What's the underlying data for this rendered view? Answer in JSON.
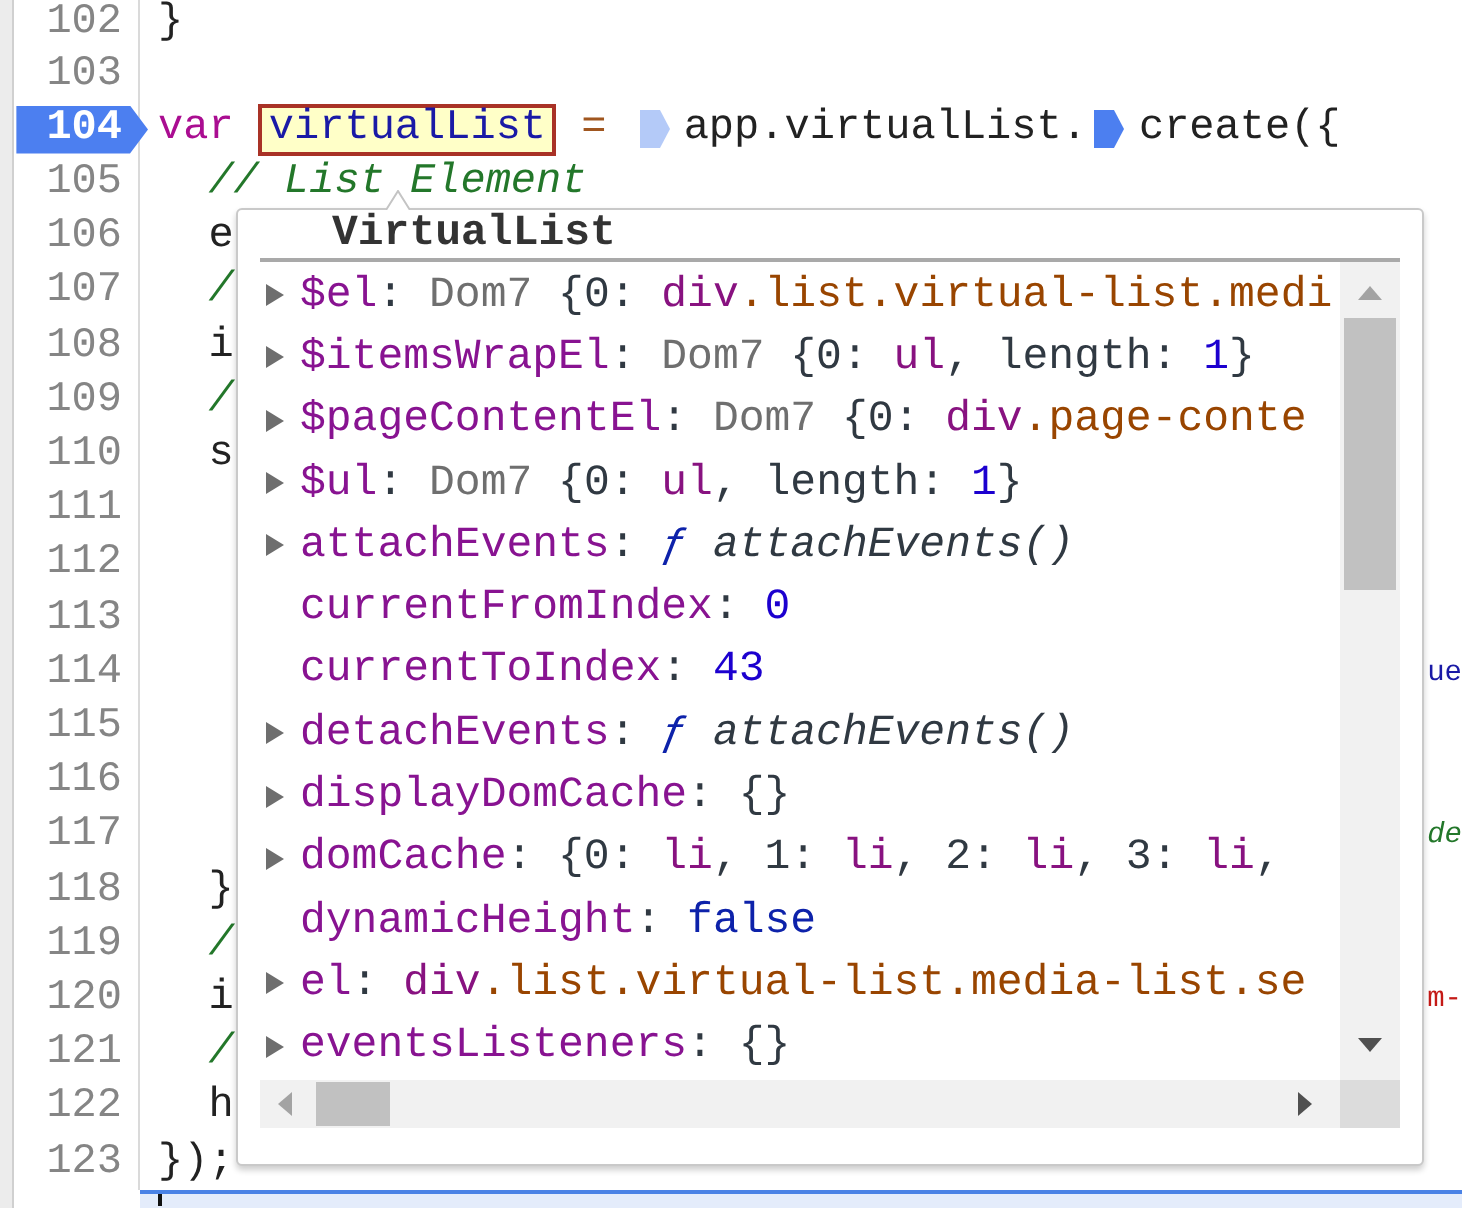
{
  "editor": {
    "lines": [
      {
        "number": "102",
        "breakpoint": false,
        "code": [
          {
            "kind": "plain",
            "text": "}"
          }
        ]
      },
      {
        "number": "103",
        "breakpoint": false
      },
      {
        "number": "104",
        "breakpoint": true,
        "code": [
          {
            "kind": "keyword",
            "text": "var"
          },
          {
            "kind": "hovered_name",
            "text": "virtualList"
          },
          {
            "kind": "operator",
            "text": "="
          },
          {
            "kind": "inline_breakpoint",
            "set": false
          },
          {
            "kind": "plain",
            "text": "app.virtualList."
          },
          {
            "kind": "inline_breakpoint",
            "set": true
          },
          {
            "kind": "plain",
            "text": "create({"
          }
        ],
        "children": [
          {
            "number": "105",
            "breakpoint": false,
            "code": [
              {
                "kind": "comment",
                "text": "// List"
              },
              {
                "kind": "comment",
                "text": "Element"
              }
            ]
          },
          {
            "number": "106",
            "breakpoint": false,
            "code": [
              {
                "kind": "plain",
                "text": "e"
              }
            ]
          },
          {
            "number": "107",
            "breakpoint": false,
            "code": [
              {
                "kind": "comment",
                "text": "/"
              }
            ]
          },
          {
            "number": "108",
            "breakpoint": false,
            "code": [
              {
                "kind": "plain",
                "text": "i"
              }
            ]
          },
          {
            "number": "109",
            "breakpoint": false,
            "code": [
              {
                "kind": "comment",
                "text": "/"
              }
            ]
          },
          {
            "number": "110",
            "breakpoint": false,
            "code": [
              {
                "kind": "plain",
                "text": "s"
              }
            ]
          },
          {
            "number": "111",
            "breakpoint": false
          },
          {
            "number": "112",
            "breakpoint": false
          },
          {
            "number": "113",
            "breakpoint": false
          },
          {
            "number": "114",
            "breakpoint": false,
            "code_right": [
              {
                "kind": "literal",
                "text": "ue"
              }
            ]
          },
          {
            "number": "115",
            "breakpoint": false
          },
          {
            "number": "116",
            "breakpoint": false
          },
          {
            "number": "117",
            "breakpoint": false,
            "code_right": [
              {
                "kind": "comment",
                "text": "de"
              }
            ]
          },
          {
            "number": "118",
            "breakpoint": false,
            "code": [
              {
                "kind": "plain",
                "text": "}"
              }
            ]
          },
          {
            "number": "119",
            "breakpoint": false,
            "code": [
              {
                "kind": "comment",
                "text": "/"
              }
            ]
          },
          {
            "number": "120",
            "breakpoint": false,
            "code": [
              {
                "kind": "plain",
                "text": "i"
              }
            ],
            "code_right": [
              {
                "kind": "string",
                "text": "m-"
              }
            ]
          },
          {
            "number": "121",
            "breakpoint": false,
            "code": [
              {
                "kind": "comment",
                "text": "/"
              }
            ]
          },
          {
            "number": "122",
            "breakpoint": false,
            "code": [
              {
                "kind": "plain",
                "text": "h"
              }
            ]
          }
        ]
      },
      {
        "number": "123",
        "breakpoint": false,
        "code": [
          {
            "kind": "plain",
            "text": "});"
          }
        ]
      }
    ]
  },
  "preview_popup": {
    "title": "VirtualList",
    "properties": [
      {
        "expanded": false,
        "parts": [
          {
            "kind": "name",
            "text": "$el"
          },
          {
            "kind": "punct",
            "text": ": "
          },
          {
            "kind": "type",
            "text": "Dom7"
          },
          {
            "kind": "punct",
            "text": " {0: "
          },
          {
            "kind": "tag",
            "text": "div"
          },
          {
            "kind": "class",
            "text": ".list.virtual-list.medi"
          }
        ]
      },
      {
        "expanded": false,
        "parts": [
          {
            "kind": "name",
            "text": "$itemsWrapEl"
          },
          {
            "kind": "punct",
            "text": ": "
          },
          {
            "kind": "type",
            "text": "Dom7"
          },
          {
            "kind": "punct",
            "text": " {0: "
          },
          {
            "kind": "tag",
            "text": "ul"
          },
          {
            "kind": "punct",
            "text": ", length: "
          },
          {
            "kind": "number",
            "text": "1"
          },
          {
            "kind": "punct",
            "text": "}"
          }
        ]
      },
      {
        "expanded": false,
        "parts": [
          {
            "kind": "name",
            "text": "$pageContentEl"
          },
          {
            "kind": "punct",
            "text": ": "
          },
          {
            "kind": "type",
            "text": "Dom7"
          },
          {
            "kind": "punct",
            "text": " {0: "
          },
          {
            "kind": "tag",
            "text": "div"
          },
          {
            "kind": "class",
            "text": ".page-conte"
          }
        ]
      },
      {
        "expanded": false,
        "parts": [
          {
            "kind": "name",
            "text": "$ul"
          },
          {
            "kind": "punct",
            "text": ": "
          },
          {
            "kind": "type",
            "text": "Dom7"
          },
          {
            "kind": "punct",
            "text": " {0: "
          },
          {
            "kind": "tag",
            "text": "ul"
          },
          {
            "kind": "punct",
            "text": ", length: "
          },
          {
            "kind": "number",
            "text": "1"
          },
          {
            "kind": "punct",
            "text": "}"
          }
        ]
      },
      {
        "expanded": false,
        "parts": [
          {
            "kind": "name",
            "text": "attachEvents"
          },
          {
            "kind": "punct",
            "text": ": "
          },
          {
            "kind": "function_sign",
            "text": "ƒ"
          },
          {
            "kind": "function",
            "text": " attachEvents()"
          }
        ]
      },
      {
        "parts": [
          {
            "kind": "name",
            "text": "currentFromIndex"
          },
          {
            "kind": "punct",
            "text": ": "
          },
          {
            "kind": "number",
            "text": "0"
          }
        ]
      },
      {
        "parts": [
          {
            "kind": "name",
            "text": "currentToIndex"
          },
          {
            "kind": "punct",
            "text": ": "
          },
          {
            "kind": "number",
            "text": "43"
          }
        ]
      },
      {
        "expanded": false,
        "parts": [
          {
            "kind": "name",
            "text": "detachEvents"
          },
          {
            "kind": "punct",
            "text": ": "
          },
          {
            "kind": "function_sign",
            "text": "ƒ"
          },
          {
            "kind": "function",
            "text": " attachEvents()"
          }
        ]
      },
      {
        "expanded": false,
        "parts": [
          {
            "kind": "name",
            "text": "displayDomCache"
          },
          {
            "kind": "punct",
            "text": ": {}"
          }
        ]
      },
      {
        "expanded": false,
        "parts": [
          {
            "kind": "name",
            "text": "domCache"
          },
          {
            "kind": "punct",
            "text": ": {0: "
          },
          {
            "kind": "tag",
            "text": "li"
          },
          {
            "kind": "punct",
            "text": ", 1: "
          },
          {
            "kind": "tag",
            "text": "li"
          },
          {
            "kind": "punct",
            "text": ", 2: "
          },
          {
            "kind": "tag",
            "text": "li"
          },
          {
            "kind": "punct",
            "text": ", 3: "
          },
          {
            "kind": "tag",
            "text": "li"
          },
          {
            "kind": "punct",
            "text": ","
          }
        ]
      },
      {
        "parts": [
          {
            "kind": "name",
            "text": "dynamicHeight"
          },
          {
            "kind": "punct",
            "text": ": "
          },
          {
            "kind": "keyword",
            "text": "false"
          }
        ]
      },
      {
        "expanded": false,
        "parts": [
          {
            "kind": "name",
            "text": "el"
          },
          {
            "kind": "punct",
            "text": ": "
          },
          {
            "kind": "tag",
            "text": "div"
          },
          {
            "kind": "class",
            "text": ".list.virtual-list.media-list.se"
          }
        ]
      },
      {
        "expanded": false,
        "parts": [
          {
            "kind": "name",
            "text": "eventsListeners"
          },
          {
            "kind": "punct",
            "text": ": {}"
          }
        ]
      }
    ]
  }
}
